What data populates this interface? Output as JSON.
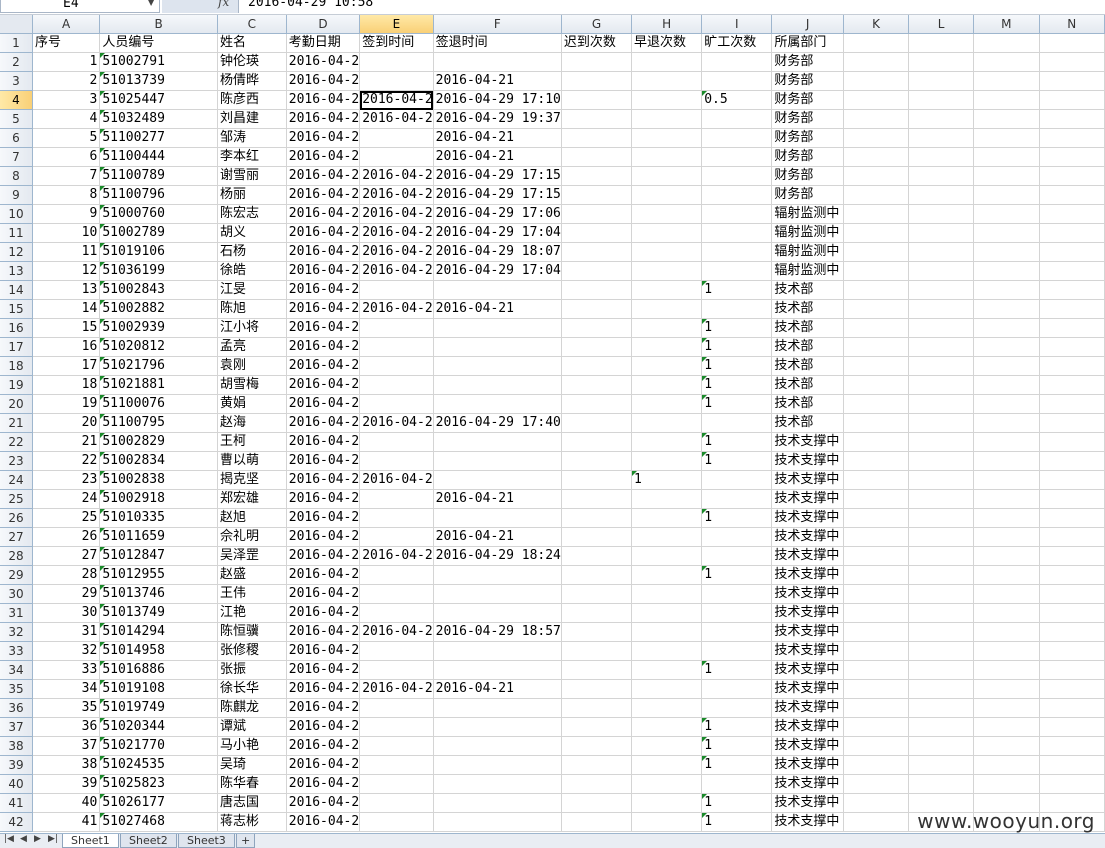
{
  "formula_bar": {
    "cell_ref": "E4",
    "formula": "2016-04-29 10:58"
  },
  "columns": [
    "A",
    "B",
    "C",
    "D",
    "E",
    "F",
    "G",
    "H",
    "I",
    "J",
    "K",
    "L",
    "M",
    "N"
  ],
  "selected_column": "E",
  "selected_row": 4,
  "active_cell": "E4",
  "header_row": {
    "A": "序号",
    "B": "人员编号",
    "C": "姓名",
    "D": "考勤日期",
    "E": "签到时间",
    "F": "签退时间",
    "G": "迟到次数",
    "H": "早退次数",
    "I": "旷工次数",
    "J": "所属部门"
  },
  "rows": [
    {
      "a": "1",
      "b": "51002791",
      "c": "钟伦瑛",
      "d": "2016-04-2",
      "e": "",
      "f": "",
      "i": "",
      "j": "财务部"
    },
    {
      "a": "2",
      "b": "51013739",
      "c": "杨倩晔",
      "d": "2016-04-2",
      "e": "",
      "f": "2016-04-21",
      "i": "",
      "j": "财务部"
    },
    {
      "a": "3",
      "b": "51025447",
      "c": "陈彦西",
      "d": "2016-04-2",
      "e": "2016-04-2",
      "f": "2016-04-29 17:10",
      "i": "0.5",
      "j": "财务部"
    },
    {
      "a": "4",
      "b": "51032489",
      "c": "刘昌建",
      "d": "2016-04-2",
      "e": "2016-04-2",
      "f": "2016-04-29 19:37",
      "i": "",
      "j": "财务部"
    },
    {
      "a": "5",
      "b": "51100277",
      "c": "邹涛",
      "d": "2016-04-2",
      "e": "",
      "f": "2016-04-21",
      "i": "",
      "j": "财务部"
    },
    {
      "a": "6",
      "b": "51100444",
      "c": "李本红",
      "d": "2016-04-2",
      "e": "",
      "f": "2016-04-21",
      "i": "",
      "j": "财务部"
    },
    {
      "a": "7",
      "b": "51100789",
      "c": "谢雪丽",
      "d": "2016-04-2",
      "e": "2016-04-2",
      "f": "2016-04-29 17:15",
      "i": "",
      "j": "财务部"
    },
    {
      "a": "8",
      "b": "51100796",
      "c": "杨丽",
      "d": "2016-04-2",
      "e": "2016-04-2",
      "f": "2016-04-29 17:15",
      "i": "",
      "j": "财务部"
    },
    {
      "a": "9",
      "b": "51000760",
      "c": "陈宏志",
      "d": "2016-04-2",
      "e": "2016-04-2",
      "f": "2016-04-29 17:06",
      "i": "",
      "j": "辐射监测中"
    },
    {
      "a": "10",
      "b": "51002789",
      "c": "胡义",
      "d": "2016-04-2",
      "e": "2016-04-2",
      "f": "2016-04-29 17:04",
      "i": "",
      "j": "辐射监测中"
    },
    {
      "a": "11",
      "b": "51019106",
      "c": "石杨",
      "d": "2016-04-2",
      "e": "2016-04-2",
      "f": "2016-04-29 18:07",
      "i": "",
      "j": "辐射监测中"
    },
    {
      "a": "12",
      "b": "51036199",
      "c": "徐皓",
      "d": "2016-04-2",
      "e": "2016-04-2",
      "f": "2016-04-29 17:04",
      "i": "",
      "j": "辐射监测中"
    },
    {
      "a": "13",
      "b": "51002843",
      "c": "江旻",
      "d": "2016-04-2",
      "e": "",
      "f": "",
      "i": "1",
      "j": "技术部"
    },
    {
      "a": "14",
      "b": "51002882",
      "c": "陈旭",
      "d": "2016-04-2",
      "e": "2016-04-2",
      "f": "2016-04-21",
      "i": "",
      "j": "技术部"
    },
    {
      "a": "15",
      "b": "51002939",
      "c": "江小将",
      "d": "2016-04-2",
      "e": "",
      "f": "",
      "i": "1",
      "j": "技术部"
    },
    {
      "a": "16",
      "b": "51020812",
      "c": "孟亮",
      "d": "2016-04-2",
      "e": "",
      "f": "",
      "i": "1",
      "j": "技术部"
    },
    {
      "a": "17",
      "b": "51021796",
      "c": "袁刚",
      "d": "2016-04-2",
      "e": "",
      "f": "",
      "i": "1",
      "j": "技术部"
    },
    {
      "a": "18",
      "b": "51021881",
      "c": "胡雪梅",
      "d": "2016-04-2",
      "e": "",
      "f": "",
      "i": "1",
      "j": "技术部"
    },
    {
      "a": "19",
      "b": "51100076",
      "c": "黄娟",
      "d": "2016-04-2",
      "e": "",
      "f": "",
      "i": "1",
      "j": "技术部"
    },
    {
      "a": "20",
      "b": "51100795",
      "c": "赵海",
      "d": "2016-04-2",
      "e": "2016-04-2",
      "f": "2016-04-29 17:40",
      "i": "",
      "j": "技术部"
    },
    {
      "a": "21",
      "b": "51002829",
      "c": "王柯",
      "d": "2016-04-2",
      "e": "",
      "f": "",
      "i": "1",
      "j": "技术支撑中"
    },
    {
      "a": "22",
      "b": "51002834",
      "c": "曹以萌",
      "d": "2016-04-2",
      "e": "",
      "f": "",
      "i": "1",
      "j": "技术支撑中"
    },
    {
      "a": "23",
      "b": "51002838",
      "c": "揭克坚",
      "d": "2016-04-2",
      "e": "2016-04-2",
      "f": "",
      "h": "1",
      "i": "",
      "j": "技术支撑中"
    },
    {
      "a": "24",
      "b": "51002918",
      "c": "郑宏雄",
      "d": "2016-04-2",
      "e": "",
      "f": "2016-04-21",
      "i": "",
      "j": "技术支撑中"
    },
    {
      "a": "25",
      "b": "51010335",
      "c": "赵旭",
      "d": "2016-04-2",
      "e": "",
      "f": "",
      "i": "1",
      "j": "技术支撑中"
    },
    {
      "a": "26",
      "b": "51011659",
      "c": "佘礼明",
      "d": "2016-04-2",
      "e": "",
      "f": "2016-04-21",
      "i": "",
      "j": "技术支撑中"
    },
    {
      "a": "27",
      "b": "51012847",
      "c": "吴泽罡",
      "d": "2016-04-2",
      "e": "2016-04-2",
      "f": "2016-04-29 18:24",
      "i": "",
      "j": "技术支撑中"
    },
    {
      "a": "28",
      "b": "51012955",
      "c": "赵盛",
      "d": "2016-04-2",
      "e": "",
      "f": "",
      "i": "1",
      "j": "技术支撑中"
    },
    {
      "a": "29",
      "b": "51013746",
      "c": "王伟",
      "d": "2016-04-2",
      "e": "",
      "f": "",
      "i": "",
      "j": "技术支撑中"
    },
    {
      "a": "30",
      "b": "51013749",
      "c": "江艳",
      "d": "2016-04-2",
      "e": "",
      "f": "",
      "i": "",
      "j": "技术支撑中"
    },
    {
      "a": "31",
      "b": "51014294",
      "c": "陈恒骥",
      "d": "2016-04-2",
      "e": "2016-04-2",
      "f": "2016-04-29 18:57",
      "i": "",
      "j": "技术支撑中"
    },
    {
      "a": "32",
      "b": "51014958",
      "c": "张修稷",
      "d": "2016-04-2",
      "e": "",
      "f": "",
      "i": "",
      "j": "技术支撑中"
    },
    {
      "a": "33",
      "b": "51016886",
      "c": "张振",
      "d": "2016-04-2",
      "e": "",
      "f": "",
      "i": "1",
      "j": "技术支撑中"
    },
    {
      "a": "34",
      "b": "51019108",
      "c": "徐长华",
      "d": "2016-04-2",
      "e": "2016-04-2",
      "f": "2016-04-21",
      "i": "",
      "j": "技术支撑中"
    },
    {
      "a": "35",
      "b": "51019749",
      "c": "陈麒龙",
      "d": "2016-04-2",
      "e": "",
      "f": "",
      "i": "",
      "j": "技术支撑中"
    },
    {
      "a": "36",
      "b": "51020344",
      "c": "谭斌",
      "d": "2016-04-2",
      "e": "",
      "f": "",
      "i": "1",
      "j": "技术支撑中"
    },
    {
      "a": "37",
      "b": "51021770",
      "c": "马小艳",
      "d": "2016-04-2",
      "e": "",
      "f": "",
      "i": "1",
      "j": "技术支撑中"
    },
    {
      "a": "38",
      "b": "51024535",
      "c": "吴琦",
      "d": "2016-04-2",
      "e": "",
      "f": "",
      "i": "1",
      "j": "技术支撑中"
    },
    {
      "a": "39",
      "b": "51025823",
      "c": "陈华春",
      "d": "2016-04-2",
      "e": "",
      "f": "",
      "i": "",
      "j": "技术支撑中"
    },
    {
      "a": "40",
      "b": "51026177",
      "c": "唐志国",
      "d": "2016-04-2",
      "e": "",
      "f": "",
      "i": "1",
      "j": "技术支撑中"
    },
    {
      "a": "41",
      "b": "51027468",
      "c": "蒋志彬",
      "d": "2016-04-2",
      "e": "",
      "f": "",
      "i": "1",
      "j": "技术支撑中"
    }
  ],
  "sheet_tabs": [
    "Sheet1",
    "Sheet2",
    "Sheet3"
  ],
  "active_sheet": "Sheet1",
  "watermark": "www.wooyun.org",
  "icons": {
    "name_box_dropdown": "chevron-down-icon",
    "formula": "fx-icon",
    "nav_first": "first-sheet-icon",
    "nav_prev": "prev-sheet-icon",
    "nav_next": "next-sheet-icon",
    "nav_last": "last-sheet-icon",
    "new_sheet": "insert-sheet-icon"
  },
  "colors": {
    "selection_header": "#f9d077",
    "comment_flag": "#1a8a2a",
    "gridline": "#d4d4d4",
    "header_border": "#9eb6ce"
  }
}
